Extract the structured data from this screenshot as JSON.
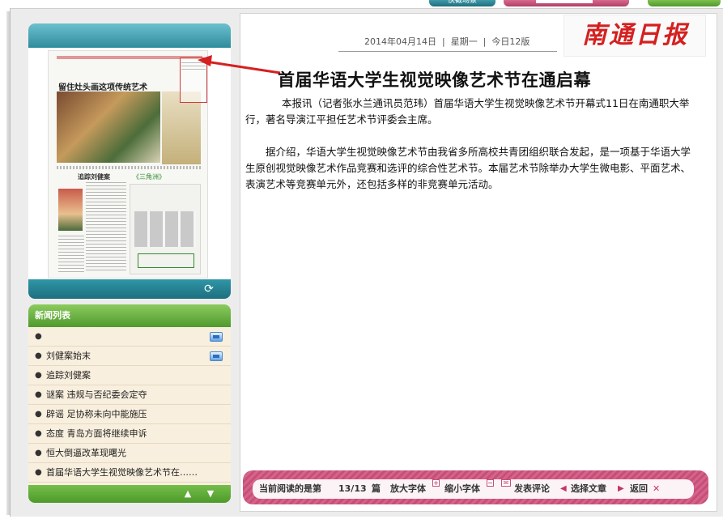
{
  "top_buttons": {
    "teal_label": "快截场景"
  },
  "thumbnail": {
    "headline": "留住灶头画这项传统艺术",
    "headline2": "追踪刘健案",
    "logo3": "《三角洲》"
  },
  "news_list": {
    "title": "新闻列表",
    "items": [
      {
        "label": "",
        "has_video": true
      },
      {
        "label": "刘健案始末",
        "has_video": true
      },
      {
        "label": "追踪刘健案",
        "has_video": false
      },
      {
        "label": "谜案 违规与否纪委会定夺",
        "has_video": false
      },
      {
        "label": "辟谣 足协称未向中能施压",
        "has_video": false
      },
      {
        "label": "态度 青岛方面将继续申诉",
        "has_video": false
      },
      {
        "label": "恒大倒逼改革现曙光",
        "has_video": false
      },
      {
        "label": "首届华语大学生视觉映像艺术节在……",
        "has_video": false
      }
    ]
  },
  "header": {
    "date": "2014年04月14日",
    "weekday": "星期一",
    "edition": "今日12版",
    "logo": "南通日报"
  },
  "article": {
    "title": "首届华语大学生视觉映像艺术节在通启幕",
    "paragraphs": [
      "本报讯（记者张水兰通讯员范玮）首届华语大学生视觉映像艺术节开幕式11日在南通职大举行，著名导演江平担任艺术节评委会主席。",
      "据介绍，华语大学生视觉映像艺术节由我省多所高校共青团组织联合发起，是一项基于华语大学生原创视觉映像艺术作品竞赛和选评的综合性艺术节。本届艺术节除举办大学生微电影、平面艺术、表演艺术等竞赛单元外，还包括多样的非竞赛单元活动。"
    ]
  },
  "toolbar": {
    "reading_prefix": "当前阅读的是第",
    "reading_value": "13/13",
    "reading_suffix": "篇",
    "zoom_in": "放大字体",
    "zoom_out": "缩小字体",
    "comment": "发表评论",
    "select_article": "选择文章",
    "back": "返回"
  },
  "colors": {
    "accent_teal": "#2e8c9c",
    "accent_green": "#4f9a2d",
    "accent_pink": "#c54f78",
    "logo_red": "#d42020"
  }
}
